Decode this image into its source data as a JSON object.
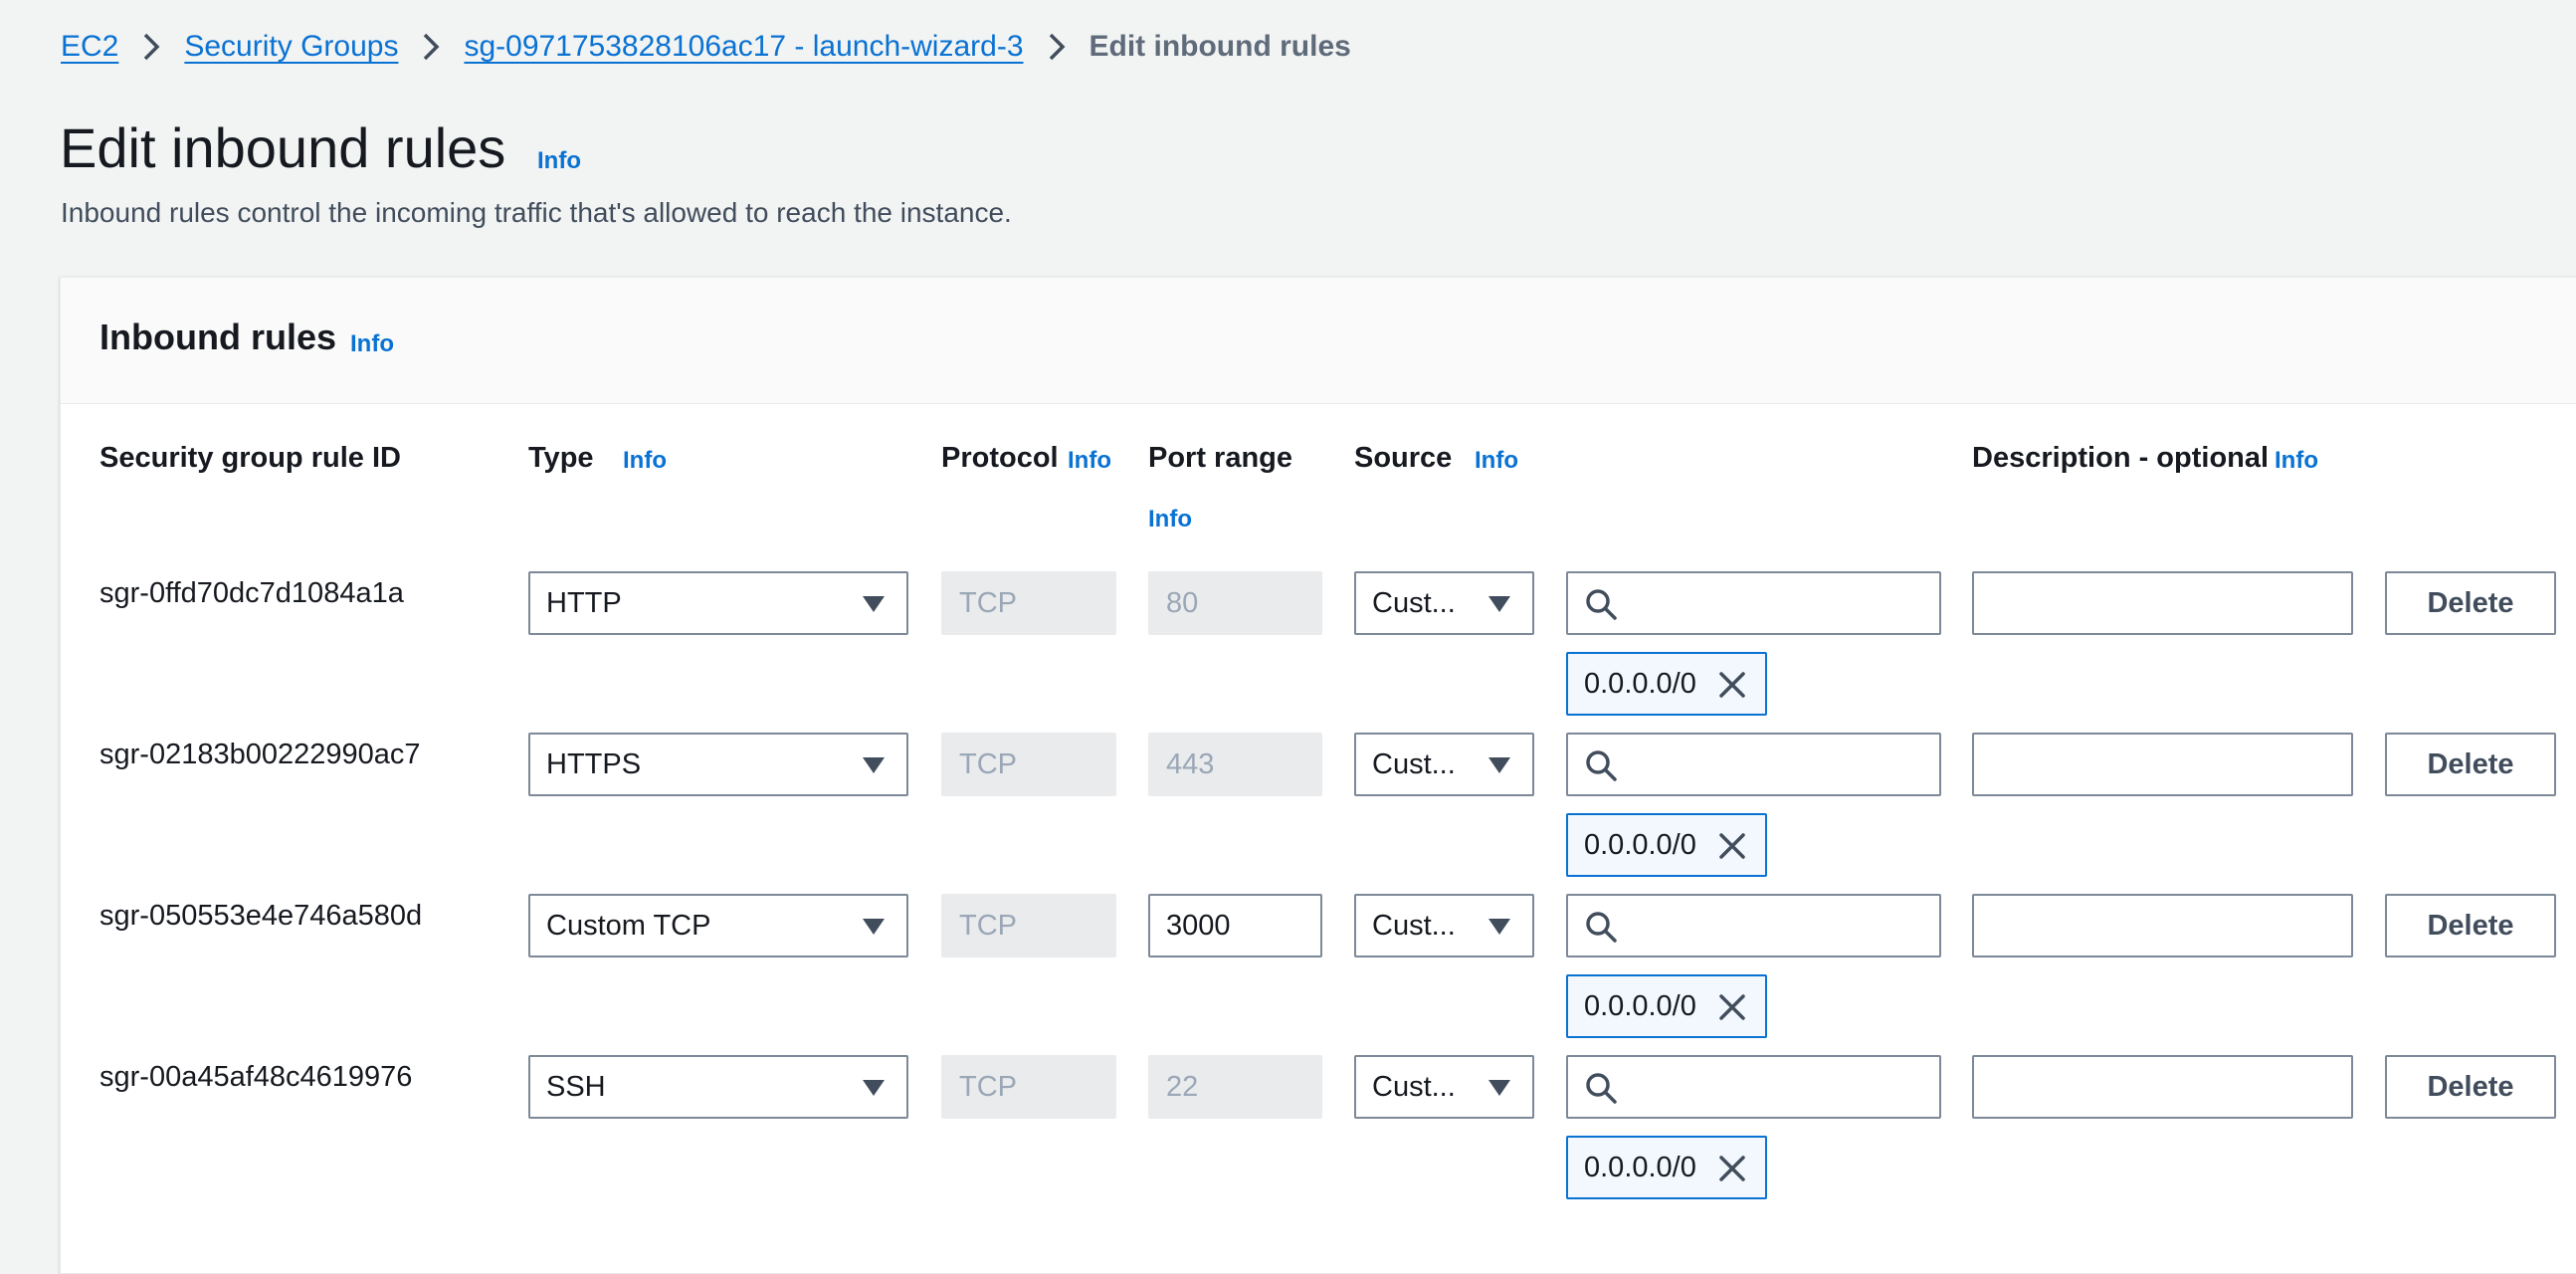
{
  "breadcrumb": {
    "items": [
      "EC2",
      "Security Groups",
      "sg-0971753828106ac17 - launch-wizard-3"
    ],
    "current": "Edit inbound rules"
  },
  "page": {
    "title": "Edit inbound rules",
    "info": "Info",
    "subtitle": "Inbound rules control the incoming traffic that's allowed to reach the instance."
  },
  "panel": {
    "title": "Inbound rules",
    "info": "Info"
  },
  "columns": {
    "rule_id": "Security group rule ID",
    "type": "Type",
    "type_info": "Info",
    "protocol": "Protocol",
    "protocol_info": "Info",
    "port_range": "Port range",
    "port_info": "Info",
    "source": "Source",
    "source_info": "Info",
    "description": "Description - optional",
    "description_info": "Info"
  },
  "rows": [
    {
      "id": "sgr-0ffd70dc7d1084a1a",
      "type": "HTTP",
      "protocol": "TCP",
      "port": "80",
      "port_editable": false,
      "source": "Cust...",
      "cidr": "0.0.0.0/0",
      "delete": "Delete"
    },
    {
      "id": "sgr-02183b00222990ac7",
      "type": "HTTPS",
      "protocol": "TCP",
      "port": "443",
      "port_editable": false,
      "source": "Cust...",
      "cidr": "0.0.0.0/0",
      "delete": "Delete"
    },
    {
      "id": "sgr-050553e4e746a580d",
      "type": "Custom TCP",
      "protocol": "TCP",
      "port": "3000",
      "port_editable": true,
      "source": "Cust...",
      "cidr": "0.0.0.0/0",
      "delete": "Delete"
    },
    {
      "id": "sgr-00a45af48c4619976",
      "type": "SSH",
      "protocol": "TCP",
      "port": "22",
      "port_editable": false,
      "source": "Cust...",
      "cidr": "0.0.0.0/0",
      "delete": "Delete"
    }
  ],
  "icons": {
    "breadcrumb_separator": "chevron-right-icon",
    "dropdown": "caret-down-icon",
    "search": "search-icon",
    "remove_token": "close-icon"
  },
  "colors": {
    "link": "#0972d3",
    "background": "#f2f3f3",
    "disabled_field": "#e9ebed",
    "token_border": "#0972d3"
  }
}
